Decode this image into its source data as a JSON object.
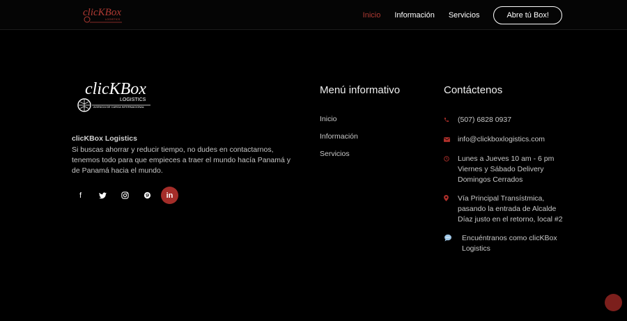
{
  "header": {
    "logo_text": "clicKBox",
    "logo_subtitle": "LOGISTICS",
    "nav": [
      {
        "label": "Inicio"
      },
      {
        "label": "Información"
      },
      {
        "label": "Servicios"
      }
    ],
    "cta_label": "Abre tú Box!"
  },
  "about": {
    "logo_text": "clicKBox",
    "logo_subtitle": "LOGISTICS",
    "logo_tagline": "AGENCIA DE CARGA INTERNACIONAL",
    "brand_name": "clicKBox Logistics",
    "description": "Si buscas ahorrar y reducir tiempo, no dudes en contactarnos, tenemos todo para que empieces a traer el mundo hacía Panamá y de Panamá hacia el mundo.",
    "social": [
      "facebook-icon",
      "twitter-icon",
      "instagram-icon",
      "pinterest-icon",
      "linkedin-icon"
    ]
  },
  "menu": {
    "title": "Menú informativo",
    "items": [
      "Inicio",
      "Información",
      "Servicios"
    ]
  },
  "contact": {
    "title": "Contáctenos",
    "phone": "(507) 6828 0937",
    "email": "info@clickboxlogistics.com",
    "hours": "Lunes a Jueves 10 am - 6 pm Viernes y Sábado Delivery Domingos Cerrados",
    "address": "Vía Principal Transístmica, pasando la entrada de Alcalde Díaz justo en el retorno, local #2",
    "social_note": "Encuéntranos como clicKBox Logistics"
  },
  "colors": {
    "accent": "#b03a33",
    "background": "#000000"
  }
}
